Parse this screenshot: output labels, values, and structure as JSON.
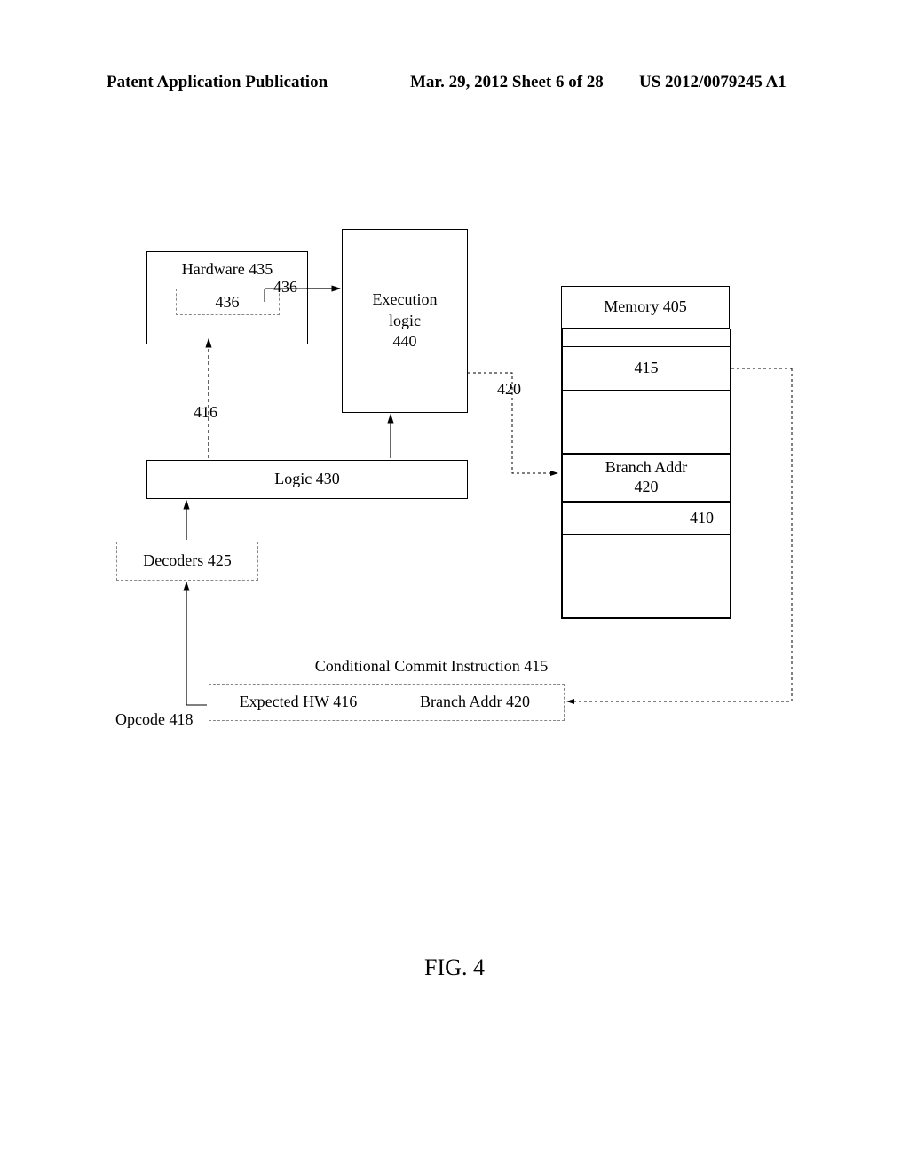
{
  "header": {
    "left": "Patent Application Publication",
    "mid": "Mar. 29, 2012  Sheet 6 of 28",
    "right": "US 2012/0079245 A1"
  },
  "figure_label": "FIG. 4",
  "hardware_box": "Hardware 435",
  "hardware_inner": "436",
  "execution_logic_box": "Execution\nlogic\n440",
  "memory_box": "Memory 405",
  "memory_415": "415",
  "memory_branch": "Branch Addr\n420",
  "memory_410": "410",
  "logic_box": "Logic   430",
  "decoders_box": "Decoders 425",
  "opcode_label": "Opcode 418",
  "expected_hw": "Expected HW 416",
  "branch_addr_field": "Branch Addr 420",
  "instr_title": "Conditional Commit Instruction 415",
  "conn_436": "436",
  "conn_416": "416",
  "conn_420": "420"
}
